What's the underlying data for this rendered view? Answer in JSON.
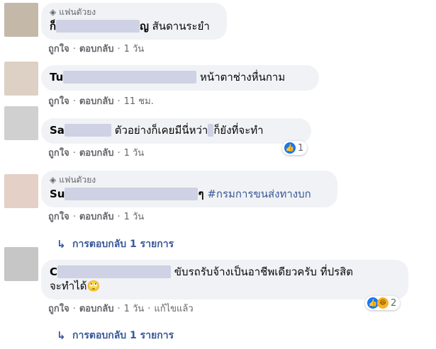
{
  "labels": {
    "fan_badge": "แฟนตัวยง",
    "like": "ถูกใจ",
    "reply": "ตอบกลับ",
    "edited": "แก้ไขแล้ว",
    "separator": "·"
  },
  "comments": [
    {
      "name": "ก็",
      "name_tail": "ญ",
      "text": "สันดานระยำ",
      "time": "1 วัน"
    },
    {
      "name": "Tu",
      "text": "หน้าตาช่างหื่นกาม",
      "time": "11 ชม."
    },
    {
      "name": "Sa",
      "text": "ตัวอย่างก็เคยมีนี่หว่า",
      "text_tail": "ก็ยังที่จะทำ",
      "time": "1 วัน",
      "reaction_count": "1"
    },
    {
      "name": "Su",
      "name_tail": "ๆ",
      "text": "#กรมการขนส่งทางบก",
      "time": "1 วัน",
      "replies": "การตอบกลับ 1 รายการ"
    },
    {
      "name": "C",
      "text": "ขับรถรับจ้างเป็นอาชีพเดียวครับ ที่ปรสิต",
      "text_line2": "จะทำได้🙄",
      "time": "1 วัน",
      "reaction_count": "2",
      "replies": "การตอบกลับ 1 รายการ"
    }
  ],
  "colors": {
    "link": "#385898",
    "meta": "#65676b",
    "bubble": "#f0f2f5",
    "like": "#1877f2"
  }
}
